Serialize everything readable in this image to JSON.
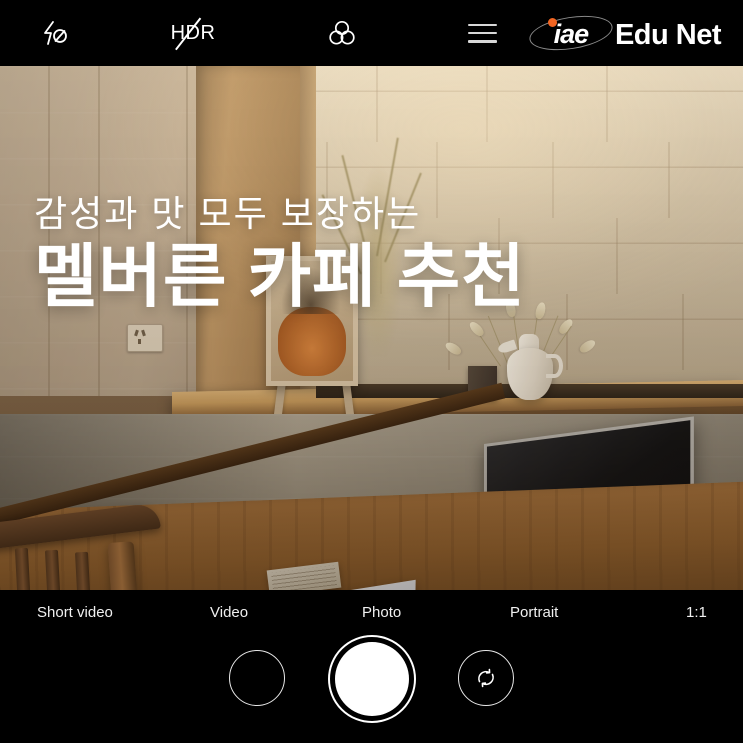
{
  "app": {
    "kind": "camera-viewfinder",
    "background_color": "#000000"
  },
  "topbar": {
    "flash": {
      "icon": "flash-off-icon",
      "label": "Flash off"
    },
    "hdr": {
      "icon": "hdr-off-icon",
      "label": "HDR"
    },
    "filters": {
      "icon": "filters-icon",
      "label": "Filters"
    },
    "menu": {
      "icon": "hamburger-menu-icon",
      "label": "Menu"
    },
    "logo": {
      "icon": "iae-edu-net-logo",
      "mark_text": "iae",
      "word_text": "Edu Net",
      "dot_color": "#f26522",
      "text_color": "#ffffff",
      "ring_color": "#8a8a8a"
    }
  },
  "overlay": {
    "subtitle": "감성과 맛 모두 보장하는",
    "title": "멜버른 카페 추천",
    "text_color": "#ffffff"
  },
  "modebar": {
    "modes": [
      {
        "label": "Short video",
        "selected": false
      },
      {
        "label": "Video",
        "selected": false
      },
      {
        "label": "Photo",
        "selected": true
      },
      {
        "label": "Portrait",
        "selected": false
      },
      {
        "label": "1:1",
        "selected": false
      }
    ]
  },
  "controls": {
    "gallery": {
      "icon": "gallery-thumbnail-icon",
      "label": "Gallery"
    },
    "shutter": {
      "icon": "shutter-button-icon",
      "label": "Shutter"
    },
    "flip": {
      "icon": "flip-camera-icon",
      "label": "Switch camera"
    }
  }
}
